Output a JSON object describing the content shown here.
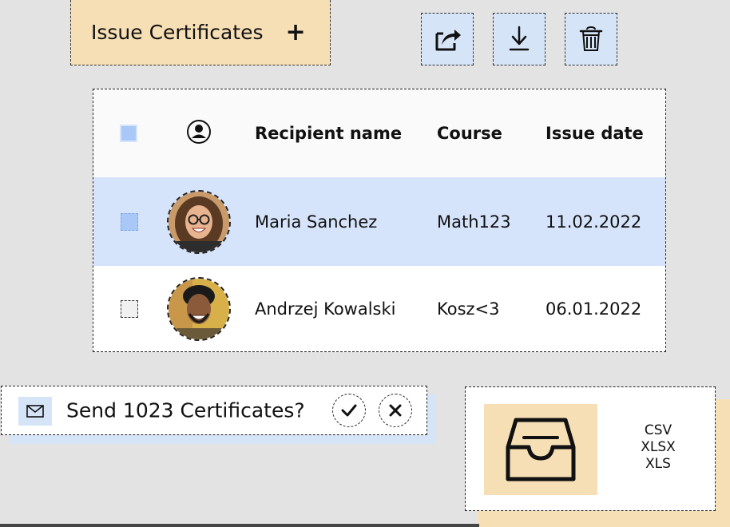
{
  "toolbar": {
    "issue_label": "Issue Certificates",
    "issue_icon": "plus-icon",
    "actions": [
      {
        "name": "share-icon"
      },
      {
        "name": "download-icon"
      },
      {
        "name": "trash-icon"
      }
    ]
  },
  "table": {
    "headers": {
      "select_all": "checkbox",
      "person_icon": "person-circle-icon",
      "name": "Recipient name",
      "course": "Course",
      "date": "Issue date"
    },
    "rows": [
      {
        "name": "Maria Sanchez",
        "course": "Math123",
        "date": "11.02.2022",
        "selected": true
      },
      {
        "name": "Andrzej Kowalski",
        "course": "Kosz<3",
        "date": "06.01.2022",
        "selected": false
      }
    ]
  },
  "send": {
    "text": "Send 1023 Certificates?",
    "confirm_icon": "check-icon",
    "cancel_icon": "close-icon",
    "mail_icon": "mail-icon"
  },
  "upload": {
    "icon": "inbox-tray-icon",
    "formats": [
      "CSV",
      "XLSX",
      "XLS"
    ]
  },
  "colors": {
    "accent_blue": "#d6e4f7",
    "accent_sand": "#f6dfb5",
    "background": "#e3e3e3"
  }
}
